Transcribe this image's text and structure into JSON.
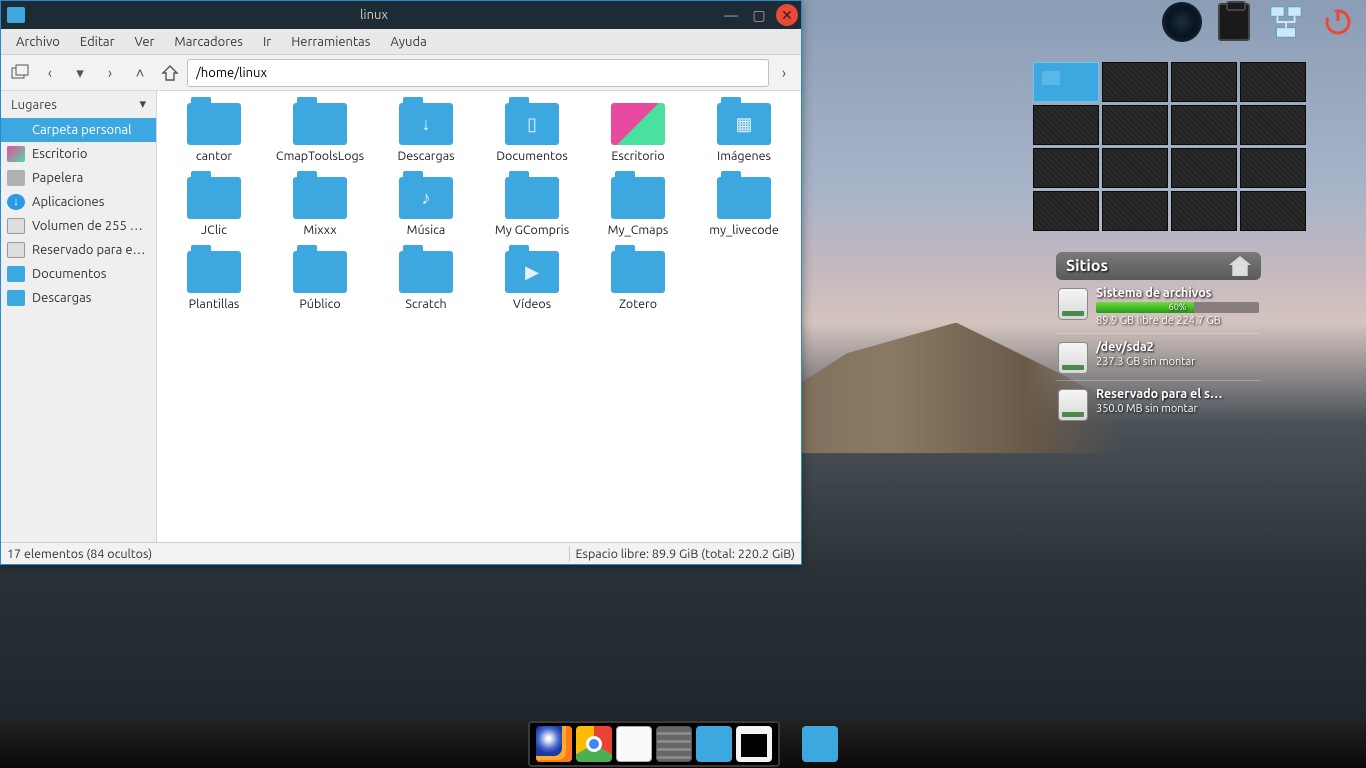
{
  "window": {
    "title": "linux",
    "menus": [
      "Archivo",
      "Editar",
      "Ver",
      "Marcadores",
      "Ir",
      "Herramientas",
      "Ayuda"
    ],
    "path": "/home/linux",
    "status_left": "17 elementos (84 ocultos)",
    "status_right": "Espacio libre: 89.9 GiB (total: 220.2 GiB)"
  },
  "sidebar": {
    "header": "Lugares",
    "items": [
      {
        "label": "Carpeta personal",
        "iconClass": "home",
        "selected": true
      },
      {
        "label": "Escritorio",
        "iconClass": "desk",
        "selected": false
      },
      {
        "label": "Papelera",
        "iconClass": "trash",
        "selected": false
      },
      {
        "label": "Aplicaciones",
        "iconClass": "apps",
        "selected": false
      },
      {
        "label": "Volumen de 255 …",
        "iconClass": "vol",
        "selected": false
      },
      {
        "label": "Reservado para e…",
        "iconClass": "vol",
        "selected": false
      },
      {
        "label": "Documentos",
        "iconClass": "docs",
        "selected": false
      },
      {
        "label": "Descargas",
        "iconClass": "dl",
        "selected": false
      }
    ]
  },
  "folders": [
    {
      "name": "cantor",
      "ic": ""
    },
    {
      "name": "CmapToolsLogs",
      "ic": ""
    },
    {
      "name": "Descargas",
      "ic": "↓"
    },
    {
      "name": "Documentos",
      "ic": "▯"
    },
    {
      "name": "Escritorio",
      "ic": "",
      "desk": true
    },
    {
      "name": "Imágenes",
      "ic": "▦"
    },
    {
      "name": "JClic",
      "ic": ""
    },
    {
      "name": "Mixxx",
      "ic": ""
    },
    {
      "name": "Música",
      "ic": "♪"
    },
    {
      "name": "My GCompris",
      "ic": ""
    },
    {
      "name": "My_Cmaps",
      "ic": ""
    },
    {
      "name": "my_livecode",
      "ic": ""
    },
    {
      "name": "Plantillas",
      "ic": ""
    },
    {
      "name": "Público",
      "ic": ""
    },
    {
      "name": "Scratch",
      "ic": ""
    },
    {
      "name": "Vídeos",
      "ic": "▶"
    },
    {
      "name": "Zotero",
      "ic": ""
    }
  ],
  "sitios": {
    "title": "Sitios",
    "rows": [
      {
        "name": "Sistema de archivos",
        "bar_pct": 60,
        "bar_label": "60%",
        "sub": "89.9 GB libre de 224.7 GB"
      },
      {
        "name": "/dev/sda2",
        "sub": "237.3 GB sin montar"
      },
      {
        "name": "Reservado para el s…",
        "sub": "350.0 MB sin montar"
      }
    ]
  },
  "workspaces": {
    "active_index": 0,
    "count": 16
  },
  "colors": {
    "accent": "#3da7e0",
    "close": "#e84a3a"
  }
}
